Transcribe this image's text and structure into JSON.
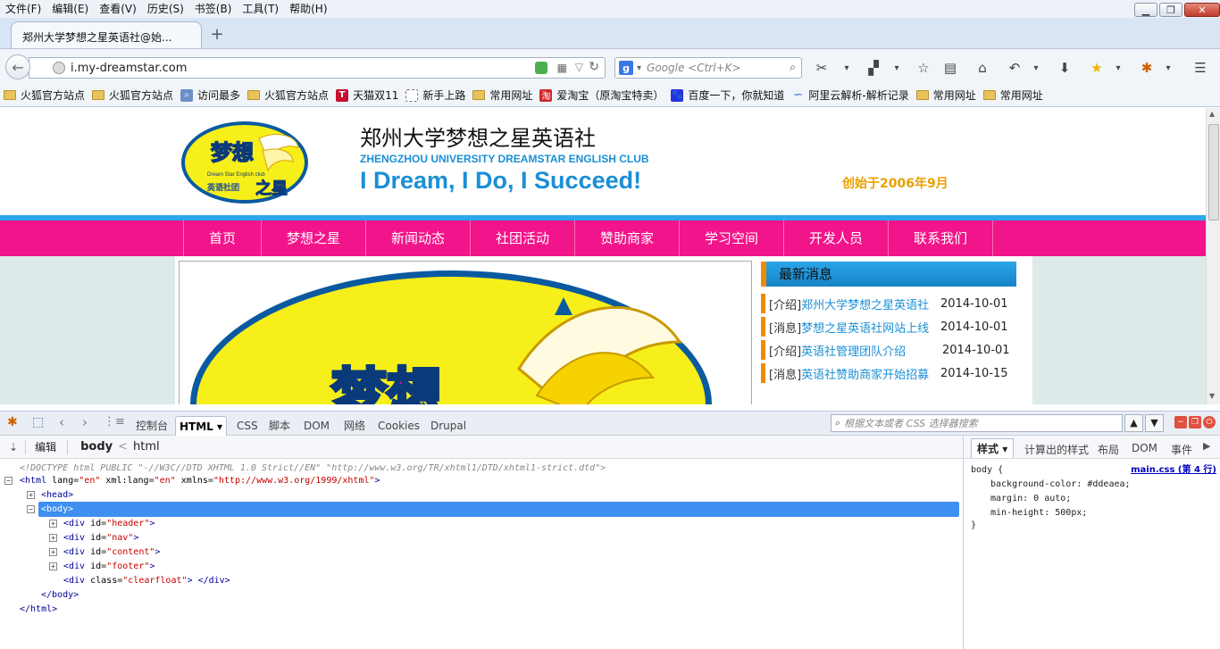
{
  "menubar": {
    "items": [
      "文件(F)",
      "编辑(E)",
      "查看(V)",
      "历史(S)",
      "书签(B)",
      "工具(T)",
      "帮助(H)"
    ]
  },
  "tab": {
    "title": "郑州大学梦想之星英语社@始...",
    "new_tab": "+"
  },
  "urlbar": {
    "url": "i.my-dreamstar.com"
  },
  "search": {
    "placeholder": "Google <Ctrl+K>"
  },
  "bookmarks": [
    {
      "label": "火狐官方站点",
      "icon": "folder-icon"
    },
    {
      "label": "火狐官方站点",
      "icon": "folder-icon"
    },
    {
      "label": "访问最多",
      "icon": "search-icon"
    },
    {
      "label": "火狐官方站点",
      "icon": "folder-icon"
    },
    {
      "label": "天猫双11",
      "icon": "tmall-icon"
    },
    {
      "label": "新手上路",
      "icon": "page-icon"
    },
    {
      "label": "常用网址",
      "icon": "folder-icon"
    },
    {
      "label": "爱淘宝（原淘宝特卖）",
      "icon": "taobao-icon"
    },
    {
      "label": "百度一下，你就知道",
      "icon": "baidu-icon"
    },
    {
      "label": "阿里云解析-解析记录",
      "icon": "aliyun-icon"
    },
    {
      "label": "常用网址",
      "icon": "folder-icon"
    },
    {
      "label": "常用网址",
      "icon": "folder-icon"
    }
  ],
  "site": {
    "title": "郑州大学梦想之星英语社",
    "subtitle": "ZHENGZHOU UNIVERSITY DREAMSTAR ENGLISH CLUB",
    "slogan": "I Dream, I Do, I Succeed!",
    "founded": "创始于2006年9月",
    "logo_text_top": "梦想",
    "logo_text_mid": "Dream Star English club",
    "logo_text_bottom": "英语社团",
    "logo_text_star": "之星",
    "nav": [
      "首页",
      "梦想之星",
      "新闻动态",
      "社团活动",
      "赞助商家",
      "学习空间",
      "开发人员",
      "联系我们"
    ],
    "news_title": "最新消息",
    "news": [
      {
        "cat": "[介绍]",
        "text": "郑州大学梦想之星英语社",
        "date": "2014-10-01"
      },
      {
        "cat": "[消息]",
        "text": "梦想之星英语社网站上线",
        "date": "2014-10-01"
      },
      {
        "cat": "[介绍]",
        "text": "英语社管理团队介绍",
        "date": "2014-10-01"
      },
      {
        "cat": "[消息]",
        "text": "英语社赞助商家开始招募",
        "date": "2014-10-15"
      }
    ],
    "banner_text": "梦想"
  },
  "devtools": {
    "tabs": [
      "控制台",
      "HTML",
      "CSS",
      "脚本",
      "DOM",
      "网络",
      "Cookies",
      "Drupal"
    ],
    "active_tab": "HTML",
    "search_placeholder": "根据文本或者 CSS 选择器搜索",
    "edit_label": "编辑",
    "breadcrumb": [
      "body",
      "html"
    ],
    "breadcrumb_sep": "<",
    "side_tabs": [
      "样式",
      "计算出的样式",
      "布局",
      "DOM",
      "事件"
    ],
    "dom": {
      "doctype": "<!DOCTYPE html PUBLIC \"-//W3C//DTD XHTML 1.0 Strict//EN\" \"http://www.w3.org/TR/xhtml1/DTD/xhtml1-strict.dtd\">",
      "html_open": "<html",
      "html_attrs": [
        {
          "name": "lang",
          "value": "en"
        },
        {
          "name": "xml:lang",
          "value": "en"
        },
        {
          "name": "xmlns",
          "value": "http://www.w3.org/1999/xhtml"
        }
      ],
      "head": "<head>",
      "body": "<body>",
      "divs": [
        {
          "attr": "id",
          "value": "header"
        },
        {
          "attr": "id",
          "value": "nav"
        },
        {
          "attr": "id",
          "value": "content"
        },
        {
          "attr": "id",
          "value": "footer"
        },
        {
          "attr": "class",
          "value": "clearfloat"
        }
      ],
      "body_close": "</body>",
      "html_close": "</html>"
    },
    "css": {
      "selector": "body {",
      "source": "main.css (第 4 行)",
      "rules": [
        {
          "prop": "background-color",
          "value": "#ddeaea;"
        },
        {
          "prop": "margin",
          "value": "0 auto;"
        },
        {
          "prop": "min-height",
          "value": "500px;"
        }
      ],
      "close": "}"
    }
  },
  "colors": {
    "accent_pink": "#f2148a",
    "accent_blue": "#1a8fd6",
    "accent_orange": "#f08a00",
    "page_bg": "#ddeaea"
  }
}
